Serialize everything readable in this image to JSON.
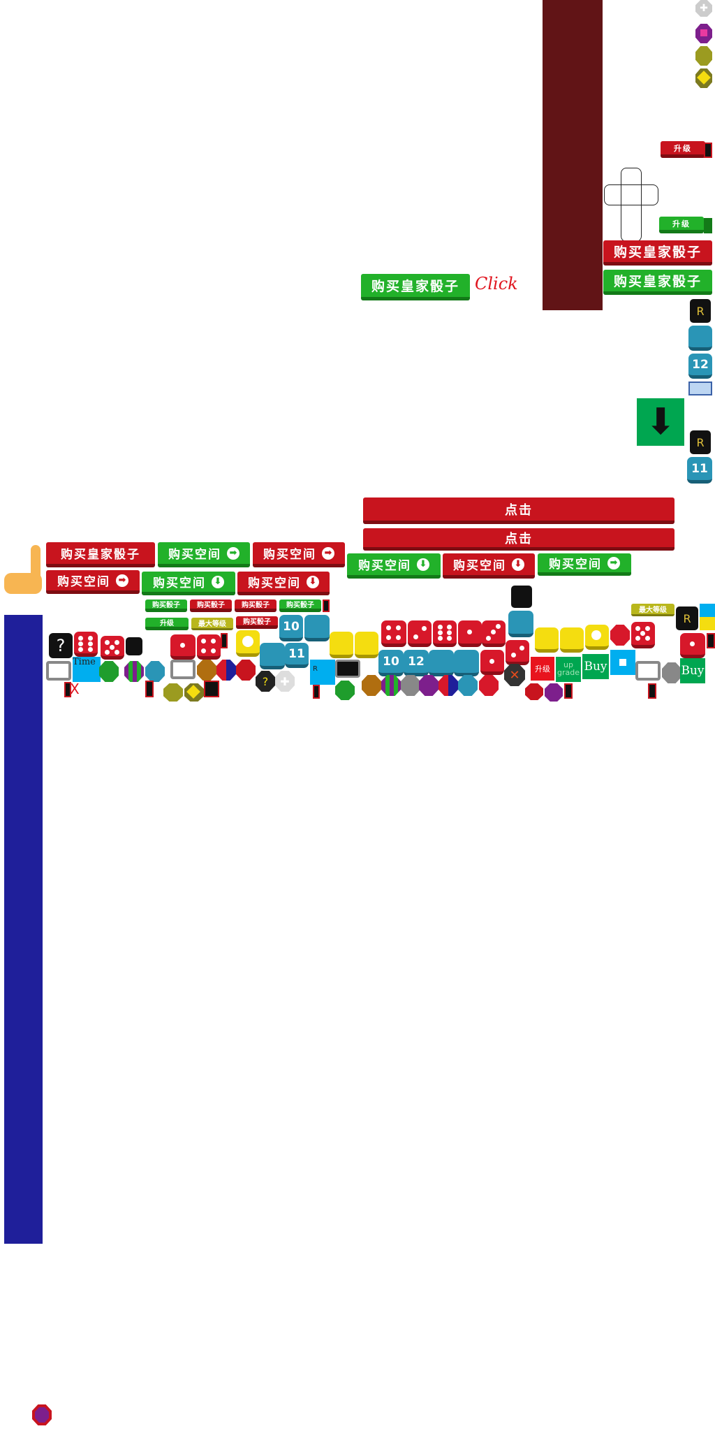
{
  "labels": {
    "buy_royal_dice": "购买皇家骰子",
    "buy_space": "购买空间",
    "buy_dice": "购买骰子",
    "upgrade": "升级",
    "max_level": "最大等级",
    "click_cn": "点击",
    "click_en": "Click",
    "time": "Time",
    "buy": "Buy",
    "up": "up",
    "grade": "grade",
    "r": "R",
    "question": "?",
    "ten": "10",
    "eleven": "11",
    "twelve": "12",
    "x": "X"
  },
  "icons": {
    "arrow_right": "➡",
    "arrow_down": "⬇",
    "big_arrow_down": "⬇",
    "cross": "✕",
    "plus": "✚"
  },
  "colors": {
    "red": "#c8141e",
    "green": "#22b12a",
    "maroon": "#611416",
    "navy": "#1f1f9a",
    "teal": "#2a95b6",
    "yellow": "#f4dd10",
    "cyan": "#00aeef",
    "purple": "#7d1f8c"
  }
}
